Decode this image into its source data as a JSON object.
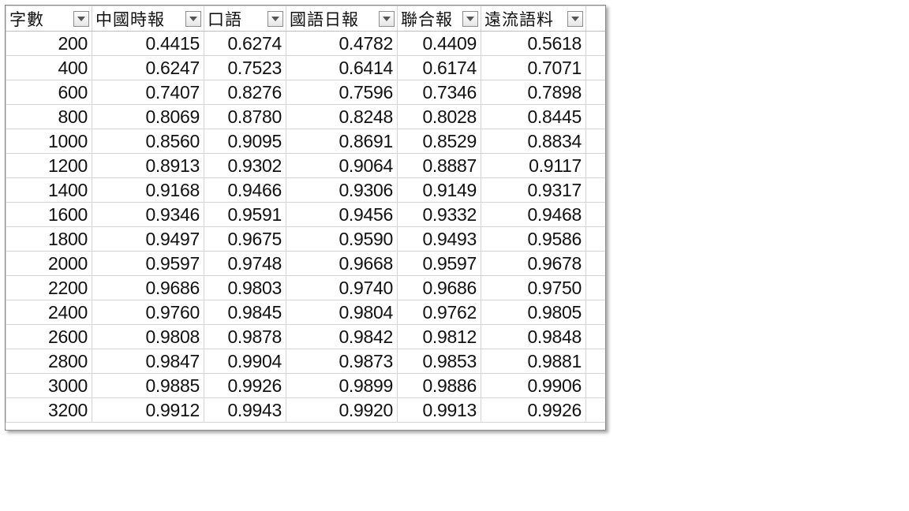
{
  "table": {
    "headers": [
      "字數",
      "中國時報",
      "口語",
      "國語日報",
      "聯合報",
      "遠流語料"
    ],
    "filter_icon": "dropdown-arrow-icon",
    "rows": [
      [
        "200",
        "0.4415",
        "0.6274",
        "0.4782",
        "0.4409",
        "0.5618"
      ],
      [
        "400",
        "0.6247",
        "0.7523",
        "0.6414",
        "0.6174",
        "0.7071"
      ],
      [
        "600",
        "0.7407",
        "0.8276",
        "0.7596",
        "0.7346",
        "0.7898"
      ],
      [
        "800",
        "0.8069",
        "0.8780",
        "0.8248",
        "0.8028",
        "0.8445"
      ],
      [
        "1000",
        "0.8560",
        "0.9095",
        "0.8691",
        "0.8529",
        "0.8834"
      ],
      [
        "1200",
        "0.8913",
        "0.9302",
        "0.9064",
        "0.8887",
        "0.9117"
      ],
      [
        "1400",
        "0.9168",
        "0.9466",
        "0.9306",
        "0.9149",
        "0.9317"
      ],
      [
        "1600",
        "0.9346",
        "0.9591",
        "0.9456",
        "0.9332",
        "0.9468"
      ],
      [
        "1800",
        "0.9497",
        "0.9675",
        "0.9590",
        "0.9493",
        "0.9586"
      ],
      [
        "2000",
        "0.9597",
        "0.9748",
        "0.9668",
        "0.9597",
        "0.9678"
      ],
      [
        "2200",
        "0.9686",
        "0.9803",
        "0.9740",
        "0.9686",
        "0.9750"
      ],
      [
        "2400",
        "0.9760",
        "0.9845",
        "0.9804",
        "0.9762",
        "0.9805"
      ],
      [
        "2600",
        "0.9808",
        "0.9878",
        "0.9842",
        "0.9812",
        "0.9848"
      ],
      [
        "2800",
        "0.9847",
        "0.9904",
        "0.9873",
        "0.9853",
        "0.9881"
      ],
      [
        "3000",
        "0.9885",
        "0.9926",
        "0.9899",
        "0.9886",
        "0.9906"
      ],
      [
        "3200",
        "0.9912",
        "0.9943",
        "0.9920",
        "0.9913",
        "0.9926"
      ]
    ]
  }
}
